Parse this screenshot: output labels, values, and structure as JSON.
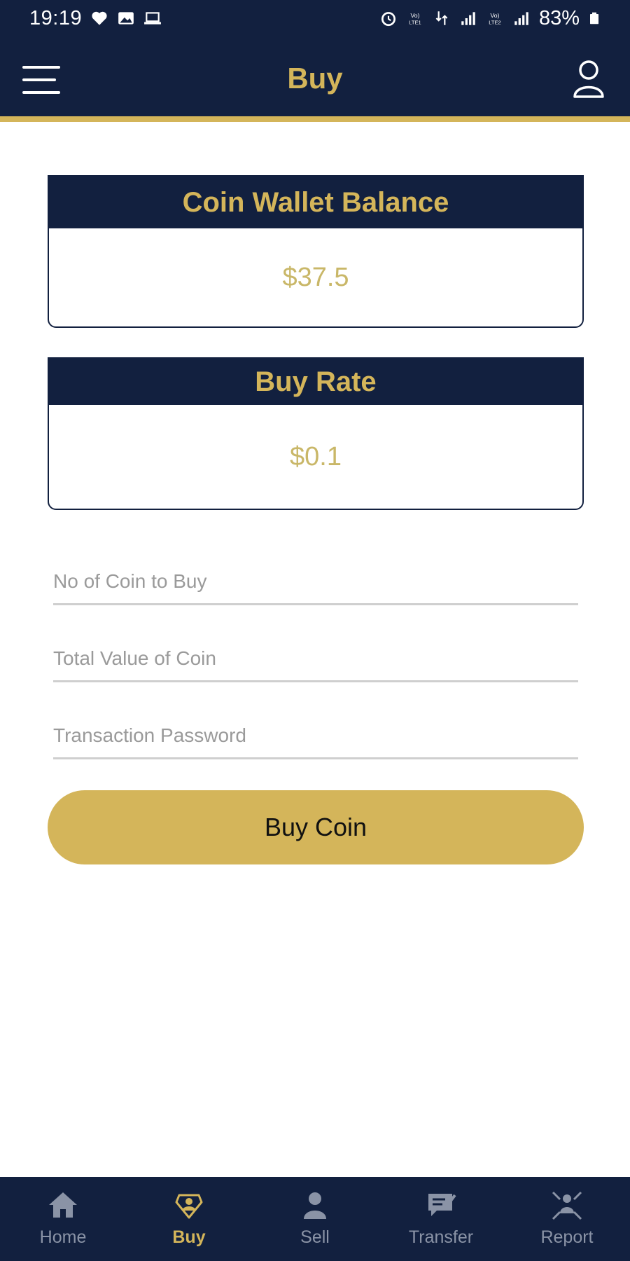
{
  "status_bar": {
    "time": "19:19",
    "battery": "83%",
    "left_icons": [
      "heart-icon",
      "image-icon",
      "laptop-icon"
    ],
    "right_icons": [
      "alarm-icon",
      "volte-icon",
      "data-icon",
      "signal-icon",
      "volte-icon",
      "signal-icon",
      "battery-icon"
    ]
  },
  "app_bar": {
    "title": "Buy",
    "menu_icon": "hamburger-menu-icon",
    "profile_icon": "user-profile-icon"
  },
  "wallet_card": {
    "title": "Coin Wallet Balance",
    "value": "$37.5"
  },
  "rate_card": {
    "title": "Buy Rate",
    "value": "$0.1"
  },
  "form": {
    "coins_placeholder": "No of Coin to Buy",
    "coins_value": "",
    "total_placeholder": "Total Value of Coin",
    "total_value": "",
    "password_placeholder": "Transaction Password",
    "password_value": ""
  },
  "buy_button": {
    "label": "Buy Coin"
  },
  "bottom_nav": {
    "items": [
      {
        "label": "Home",
        "icon": "home-icon",
        "active": false
      },
      {
        "label": "Buy",
        "icon": "buy-icon",
        "active": true
      },
      {
        "label": "Sell",
        "icon": "person-icon",
        "active": false
      },
      {
        "label": "Transfer",
        "icon": "transfer-icon",
        "active": false
      },
      {
        "label": "Report",
        "icon": "report-icon",
        "active": false
      }
    ]
  },
  "colors": {
    "navy": "#12203f",
    "gold": "#d4b55a",
    "value_text": "#c9b768",
    "nav_inactive": "#8a93a6"
  }
}
